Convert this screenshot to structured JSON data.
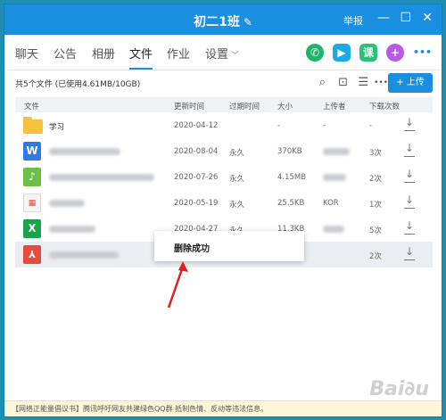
{
  "window": {
    "title": "初二1班",
    "report": "举报",
    "min": "—",
    "max": "☐",
    "close": "✕"
  },
  "tabs": [
    {
      "label": "聊天"
    },
    {
      "label": "公告"
    },
    {
      "label": "相册"
    },
    {
      "label": "文件",
      "active": true
    },
    {
      "label": "作业"
    },
    {
      "label": "设置"
    }
  ],
  "toolbar": {
    "summary": "共5个文件 (已使用4.61MB/10GB)",
    "upload": "+ 上传",
    "more": "•••"
  },
  "table": {
    "headers": [
      "文件",
      "更新时间",
      "过期时间",
      "大小",
      "上传者",
      "下载次数"
    ],
    "rows": [
      {
        "name": "学习",
        "type": "folder",
        "updated": "2020-04-12",
        "expire": "",
        "size": "-",
        "uploader": "-",
        "downloads": "-"
      },
      {
        "name": "",
        "type": "word",
        "updated": "2020-08-04",
        "expire": "永久",
        "size": "370KB",
        "uploader": "",
        "downloads": "3次"
      },
      {
        "name": "",
        "type": "audio",
        "updated": "2020-07-26",
        "expire": "永久",
        "size": "4.15MB",
        "uploader": "",
        "downloads": "2次"
      },
      {
        "name": "",
        "type": "image",
        "updated": "2020-05-19",
        "expire": "永久",
        "size": "25.5KB",
        "uploader": "KOR",
        "downloads": "1次"
      },
      {
        "name": "",
        "type": "excel",
        "updated": "2020-04-27",
        "expire": "永久",
        "size": "11.3KB",
        "uploader": "",
        "downloads": "5次"
      },
      {
        "name": "",
        "type": "pdf",
        "updated": "",
        "expire": "",
        "size": "",
        "uploader": "",
        "downloads": "2次"
      }
    ]
  },
  "popup": {
    "message": "删除成功"
  },
  "footer": {
    "notice": "【网络正能量倡议书】腾讯呼吁网友共建绿色QQ群 抵制色情、反动等违法信息。"
  },
  "colors": {
    "accent": "#1a8fe0",
    "folder": "#f7c23b",
    "word": "#2f7be5",
    "excel": "#1ba34c",
    "pdf": "#e84a3c",
    "audio": "#6cc04a"
  }
}
